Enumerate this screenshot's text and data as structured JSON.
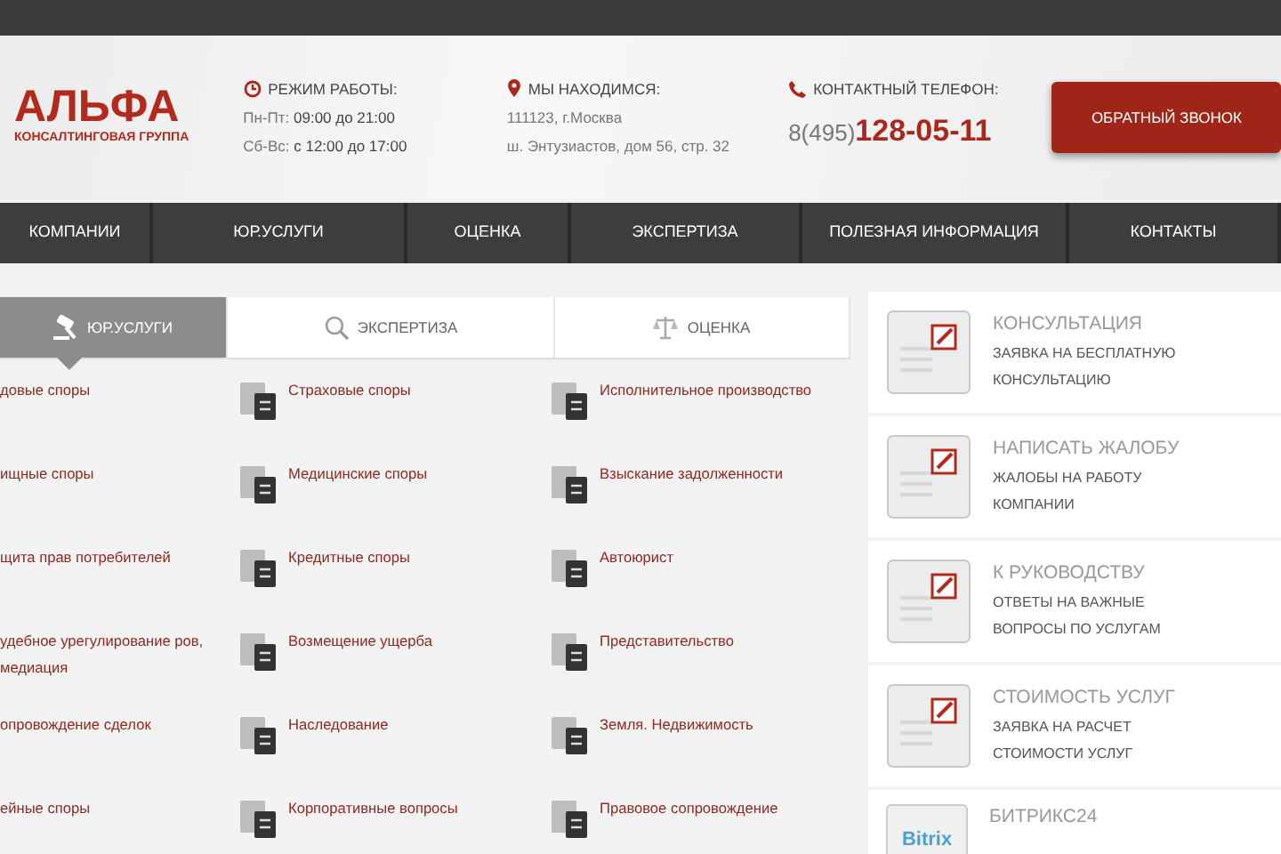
{
  "header": {
    "logo": {
      "name": "АЛЬФА",
      "tagline": "КОНСАЛТИНГОВАЯ ГРУППА"
    },
    "hours": {
      "title": "РЕЖИМ РАБОТЫ:",
      "lines": [
        {
          "days": "Пн-Пт:",
          "time": "09:00 до 21:00"
        },
        {
          "days": "Сб-Вс:",
          "time": "с 12:00 до 17:00"
        }
      ]
    },
    "address": {
      "title": "МЫ НАХОДИМСЯ:",
      "lines": [
        "111123, г.Москва",
        "ш. Энтузиастов, дом 56, стр. 32"
      ]
    },
    "phone": {
      "title": "КОНТАКТНЫЙ ТЕЛЕФОН:",
      "code": "8(495)",
      "number": "128-05-11"
    },
    "callback_button": "ОБРАТНЫЙ ЗВОНОК"
  },
  "nav": [
    "КОМПАНИИ",
    "ЮР.УСЛУГИ",
    "ОЦЕНКА",
    "ЭКСПЕРТИЗА",
    "ПОЛЕЗНАЯ ИНФОРМАЦИЯ",
    "КОНТАКТЫ"
  ],
  "tabs": [
    {
      "label": "ЮР.УСЛУГИ",
      "selected": true,
      "kind": "gavel"
    },
    {
      "label": "ЭКСПЕРТИЗА",
      "selected": false,
      "kind": "search"
    },
    {
      "label": "ОЦЕНКА",
      "selected": false,
      "kind": "scales"
    }
  ],
  "services": [
    [
      "довые споры",
      "ищные споры",
      "щита прав потребителей",
      "удебное урегулирование ров, медиация",
      "опровождение сделок",
      "ейные споры"
    ],
    [
      "Страховые споры",
      "Медицинские споры",
      "Кредитные споры",
      "Возмещение ущерба",
      "Наследование",
      "Корпоративные вопросы"
    ],
    [
      "Исполнительное производство",
      "Взыскание задолженности",
      "Автоюрист",
      "Представительство",
      "Земля. Недвижимость",
      "Правовое сопровождение"
    ]
  ],
  "sidebar": [
    {
      "kind": "form",
      "title": "КОНСУЛЬТАЦИЯ",
      "subtitle": "ЗАЯВКА НА БЕСПЛАТНУЮ КОНСУЛЬТАЦИЮ"
    },
    {
      "kind": "form",
      "title": "НАПИСАТЬ ЖАЛОБУ",
      "subtitle": "ЖАЛОБЫ НА РАБОТУ КОМПАНИИ"
    },
    {
      "kind": "form",
      "title": "К РУКОВОДСТВУ",
      "subtitle": "ОТВЕТЫ НА ВАЖНЫЕ ВОПРОСЫ ПО УСЛУГАМ"
    },
    {
      "kind": "form",
      "title": "СТОИМОСТЬ УСЛУГ",
      "subtitle": "ЗАЯВКА НА РАСЧЕТ СТОИМОСТИ УСЛУГ"
    },
    {
      "kind": "bitrix",
      "title": "БИТРИКС24",
      "logo": "Bitrix"
    }
  ]
}
